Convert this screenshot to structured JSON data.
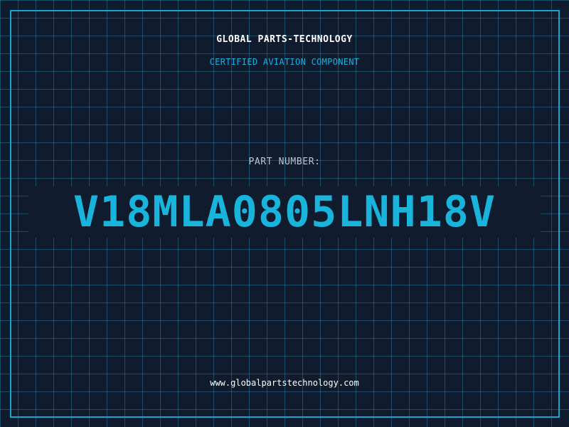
{
  "header": {
    "company": "GLOBAL PARTS-TECHNOLOGY",
    "subtitle": "CERTIFIED AVIATION COMPONENT"
  },
  "part": {
    "label": "PART NUMBER:",
    "number": "V18MLA0805LNH18V"
  },
  "footer": {
    "website": "www.globalpartstechnology.com"
  },
  "colors": {
    "background": "#111b2e",
    "grid": "#288caa",
    "accent": "#19b4dc",
    "frame": "#16a3cc",
    "label": "#b8c4d2",
    "text": "#ffffff"
  }
}
